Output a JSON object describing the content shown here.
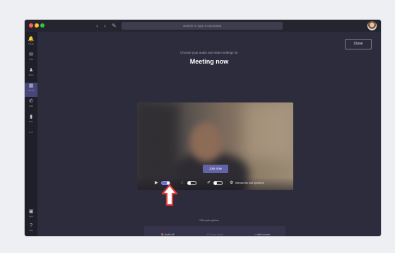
{
  "search": {
    "placeholder": "Search or type a command"
  },
  "rail": [
    {
      "icon": "bell-icon",
      "glyph": "🔔",
      "label": "Activity"
    },
    {
      "icon": "chat-icon",
      "glyph": "✉",
      "label": "Chat"
    },
    {
      "icon": "teams-icon",
      "glyph": "♟",
      "label": "Teams"
    },
    {
      "icon": "calendar-icon",
      "glyph": "▦",
      "label": "Calendar"
    },
    {
      "icon": "phone-icon",
      "glyph": "✆",
      "label": "Calls"
    },
    {
      "icon": "file-icon",
      "glyph": "▮",
      "label": "Files"
    },
    {
      "icon": "more-icon",
      "glyph": "···",
      "label": ""
    },
    {
      "icon": "apps-icon",
      "glyph": "▣",
      "label": "Apps"
    },
    {
      "icon": "help-icon",
      "glyph": "?",
      "label": "Help"
    }
  ],
  "main": {
    "close_label": "Close",
    "subtitle": "Choose your audio and video settings for",
    "title": "Meeting now",
    "join_label": "Join now",
    "device_label": "Internal Mic and Speakers",
    "other_label": "Other join options",
    "options": [
      {
        "label": "Audio off",
        "glyph": "🔇"
      },
      {
        "label": "Phone audio",
        "glyph": "✆"
      },
      {
        "label": "Add a room",
        "glyph": "▭"
      }
    ]
  },
  "controls": {
    "camera_on": true,
    "blur_on": false,
    "mic_on": false
  },
  "colors": {
    "accent": "#6264a7",
    "arrow": "#e53935"
  }
}
